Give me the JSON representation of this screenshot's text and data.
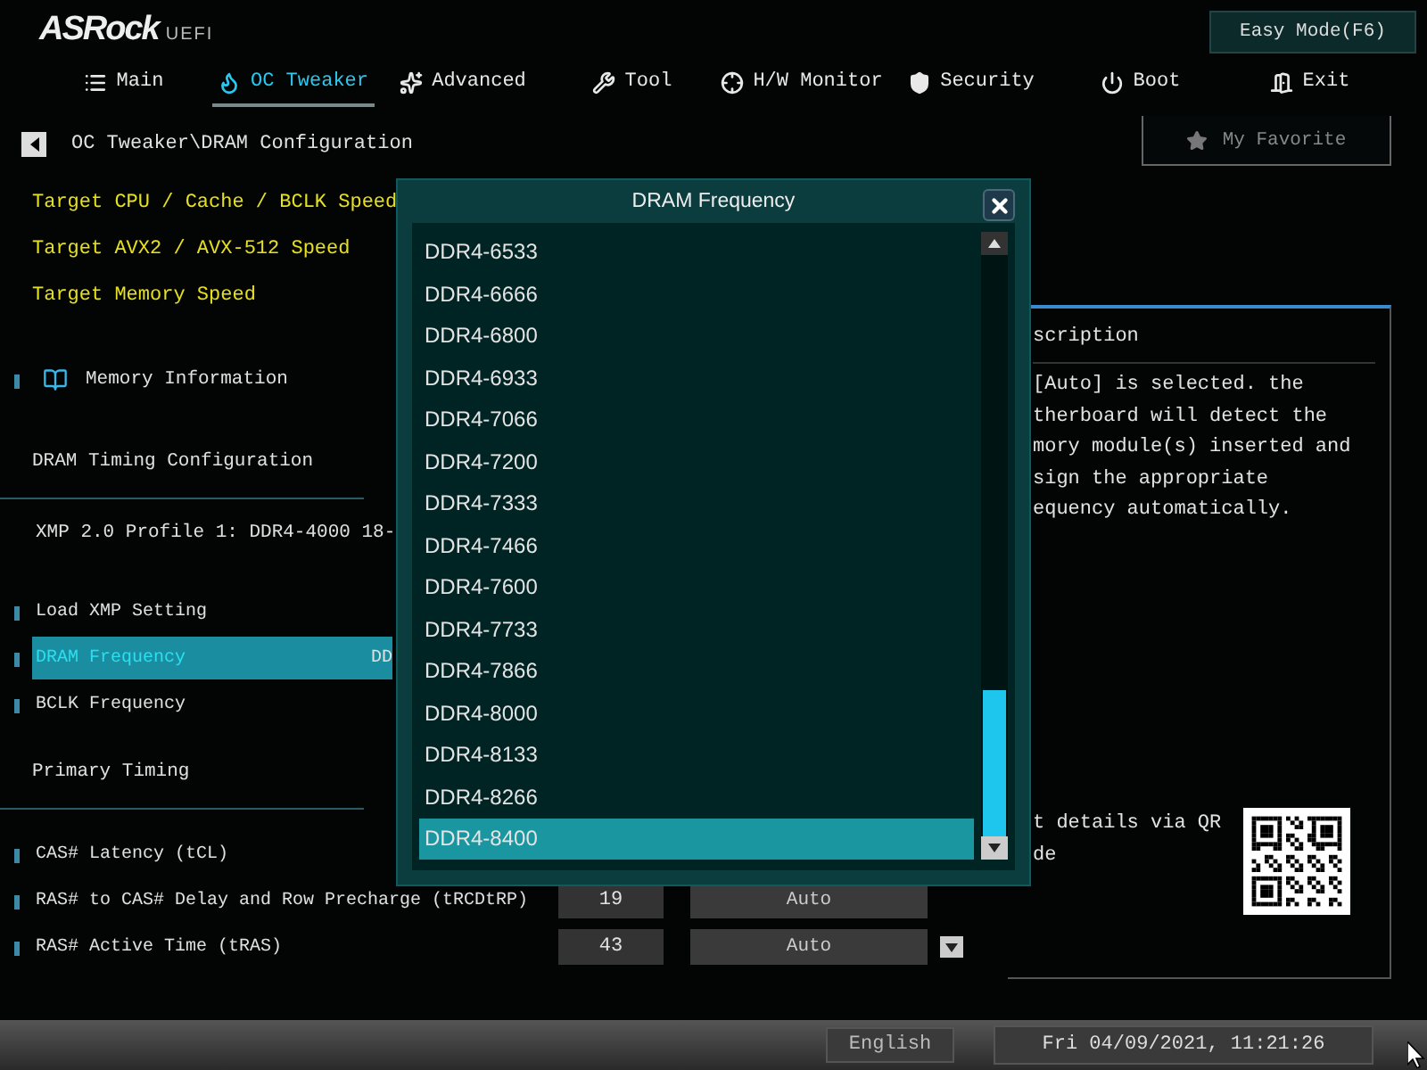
{
  "logo": {
    "brand": "ASRock",
    "suffix": "UEFI"
  },
  "mode_button": "Easy Mode(F6)",
  "tabs": [
    {
      "label": "Main",
      "selected": false
    },
    {
      "label": "OC Tweaker",
      "selected": true
    },
    {
      "label": "Advanced",
      "selected": false
    },
    {
      "label": "Tool",
      "selected": false
    },
    {
      "label": "H/W Monitor",
      "selected": false
    },
    {
      "label": "Security",
      "selected": false
    },
    {
      "label": "Boot",
      "selected": false
    },
    {
      "label": "Exit",
      "selected": false
    }
  ],
  "breadcrumb": "OC Tweaker\\DRAM Configuration",
  "favorite_button": "My Favorite",
  "items": [
    {
      "kind": "target",
      "label": "Target CPU / Cache / BCLK Speed"
    },
    {
      "kind": "target",
      "label": "Target AVX2 / AVX-512 Speed"
    },
    {
      "kind": "target",
      "label": "Target Memory Speed"
    },
    {
      "kind": "info",
      "label": "Memory Information"
    },
    {
      "kind": "header",
      "label": "DRAM Timing Configuration"
    },
    {
      "kind": "profile",
      "label": "XMP 2.0 Profile 1: DDR4-4000 18-"
    },
    {
      "kind": "setting",
      "label": "Load XMP Setting",
      "selected": false
    },
    {
      "kind": "setting",
      "label": "DRAM Frequency",
      "selected": true,
      "value": "DD"
    },
    {
      "kind": "setting",
      "label": "BCLK Frequency",
      "selected": false
    },
    {
      "kind": "header",
      "label": "Primary Timing"
    },
    {
      "kind": "setting",
      "label": "CAS# Latency (tCL)",
      "selected": false
    },
    {
      "kind": "setting",
      "label": "RAS# to CAS# Delay and Row Precharge (tRCDtRP)",
      "selected": false,
      "number": "19",
      "mode": "Auto",
      "dropdown": false
    },
    {
      "kind": "setting",
      "label": "RAS# Active Time (tRAS)",
      "selected": false,
      "number": "43",
      "mode": "Auto",
      "dropdown": true
    }
  ],
  "description": {
    "title": "scription",
    "lines": [
      "[Auto] is selected. the",
      "therboard will detect the",
      "mory module(s) inserted and",
      "sign the appropriate",
      "equency automatically."
    ],
    "qr_note": [
      "t details via QR",
      "de"
    ]
  },
  "dialog": {
    "title": "DRAM Frequency",
    "options": [
      {
        "label": "DDR4-6533",
        "selected": false
      },
      {
        "label": "DDR4-6666",
        "selected": false
      },
      {
        "label": "DDR4-6800",
        "selected": false
      },
      {
        "label": "DDR4-6933",
        "selected": false
      },
      {
        "label": "DDR4-7066",
        "selected": false
      },
      {
        "label": "DDR4-7200",
        "selected": false
      },
      {
        "label": "DDR4-7333",
        "selected": false
      },
      {
        "label": "DDR4-7466",
        "selected": false
      },
      {
        "label": "DDR4-7600",
        "selected": false
      },
      {
        "label": "DDR4-7733",
        "selected": false
      },
      {
        "label": "DDR4-7866",
        "selected": false
      },
      {
        "label": "DDR4-8000",
        "selected": false
      },
      {
        "label": "DDR4-8133",
        "selected": false
      },
      {
        "label": "DDR4-8266",
        "selected": false
      },
      {
        "label": "DDR4-8400",
        "selected": true
      }
    ]
  },
  "status_bar": {
    "language": "English",
    "datetime": "Fri 04/09/2021, 11:21:26"
  }
}
